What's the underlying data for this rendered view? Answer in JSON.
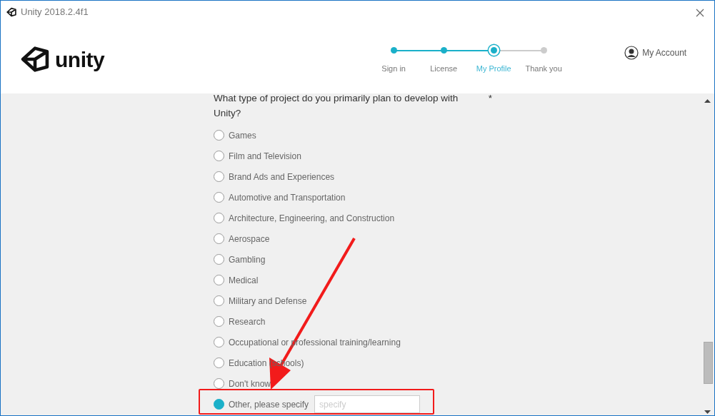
{
  "window": {
    "title": "Unity 2018.2.4f1"
  },
  "brand": {
    "wordmark": "unity"
  },
  "steps": [
    {
      "label": "Sign in",
      "done": true,
      "selected": false
    },
    {
      "label": "License",
      "done": true,
      "selected": false
    },
    {
      "label": "My Profile",
      "done": false,
      "selected": true
    },
    {
      "label": "Thank you",
      "done": false,
      "selected": false
    }
  ],
  "account": {
    "label": "My Account"
  },
  "question": {
    "text": "What type of project do you primarily plan to develop with Unity?",
    "required_mark": "*"
  },
  "options": [
    {
      "label": "Games",
      "selected": false
    },
    {
      "label": "Film and Television",
      "selected": false
    },
    {
      "label": "Brand Ads and Experiences",
      "selected": false
    },
    {
      "label": "Automotive and Transportation",
      "selected": false
    },
    {
      "label": "Architecture, Engineering, and Construction",
      "selected": false
    },
    {
      "label": "Aerospace",
      "selected": false
    },
    {
      "label": "Gambling",
      "selected": false
    },
    {
      "label": "Medical",
      "selected": false
    },
    {
      "label": "Military and Defense",
      "selected": false
    },
    {
      "label": "Research",
      "selected": false
    },
    {
      "label": "Occupational or professional training/learning",
      "selected": false
    },
    {
      "label": "Education (schools)",
      "selected": false
    },
    {
      "label": "Don't know",
      "selected": false
    },
    {
      "label": "Other, please specify",
      "selected": true,
      "kind": "other",
      "placeholder": "specify"
    }
  ]
}
